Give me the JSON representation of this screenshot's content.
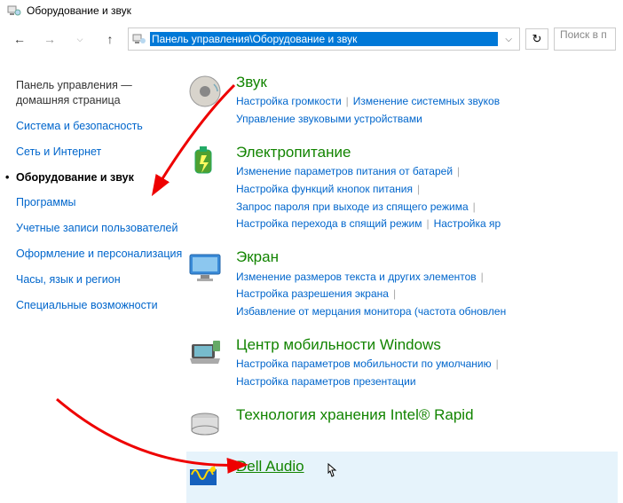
{
  "window": {
    "title": "Оборудование и звук"
  },
  "address_bar": {
    "path": "Панель управления\\Оборудование и звук"
  },
  "search": {
    "placeholder": "Поиск в п"
  },
  "sidebar": {
    "home": "Панель управления — домашняя страница",
    "items": [
      "Система и безопасность",
      "Сеть и Интернет",
      "Оборудование и звук",
      "Программы",
      "Учетные записи пользователей",
      "Оформление и персонализация",
      "Часы, язык и регион",
      "Специальные возможности"
    ]
  },
  "categories": [
    {
      "title": "Звук",
      "links": [
        "Настройка громкости",
        "Изменение системных звуков",
        "Управление звуковыми устройствами"
      ]
    },
    {
      "title": "Электропитание",
      "links": [
        "Изменение параметров питания от батарей",
        "Настройка функций кнопок питания",
        "Запрос пароля при выходе из спящего режима",
        "Настройка перехода в спящий режим",
        "Настройка яр"
      ]
    },
    {
      "title": "Экран",
      "links": [
        "Изменение размеров текста и других элементов",
        "Настройка разрешения экрана",
        "Избавление от мерцания монитора (частота обновлен"
      ]
    },
    {
      "title": "Центр мобильности Windows",
      "links": [
        "Настройка параметров мобильности по умолчанию",
        "Настройка параметров презентации"
      ]
    },
    {
      "title": "Технология хранения Intel® Rapid",
      "links": []
    },
    {
      "title": "Dell Audio",
      "links": []
    }
  ]
}
